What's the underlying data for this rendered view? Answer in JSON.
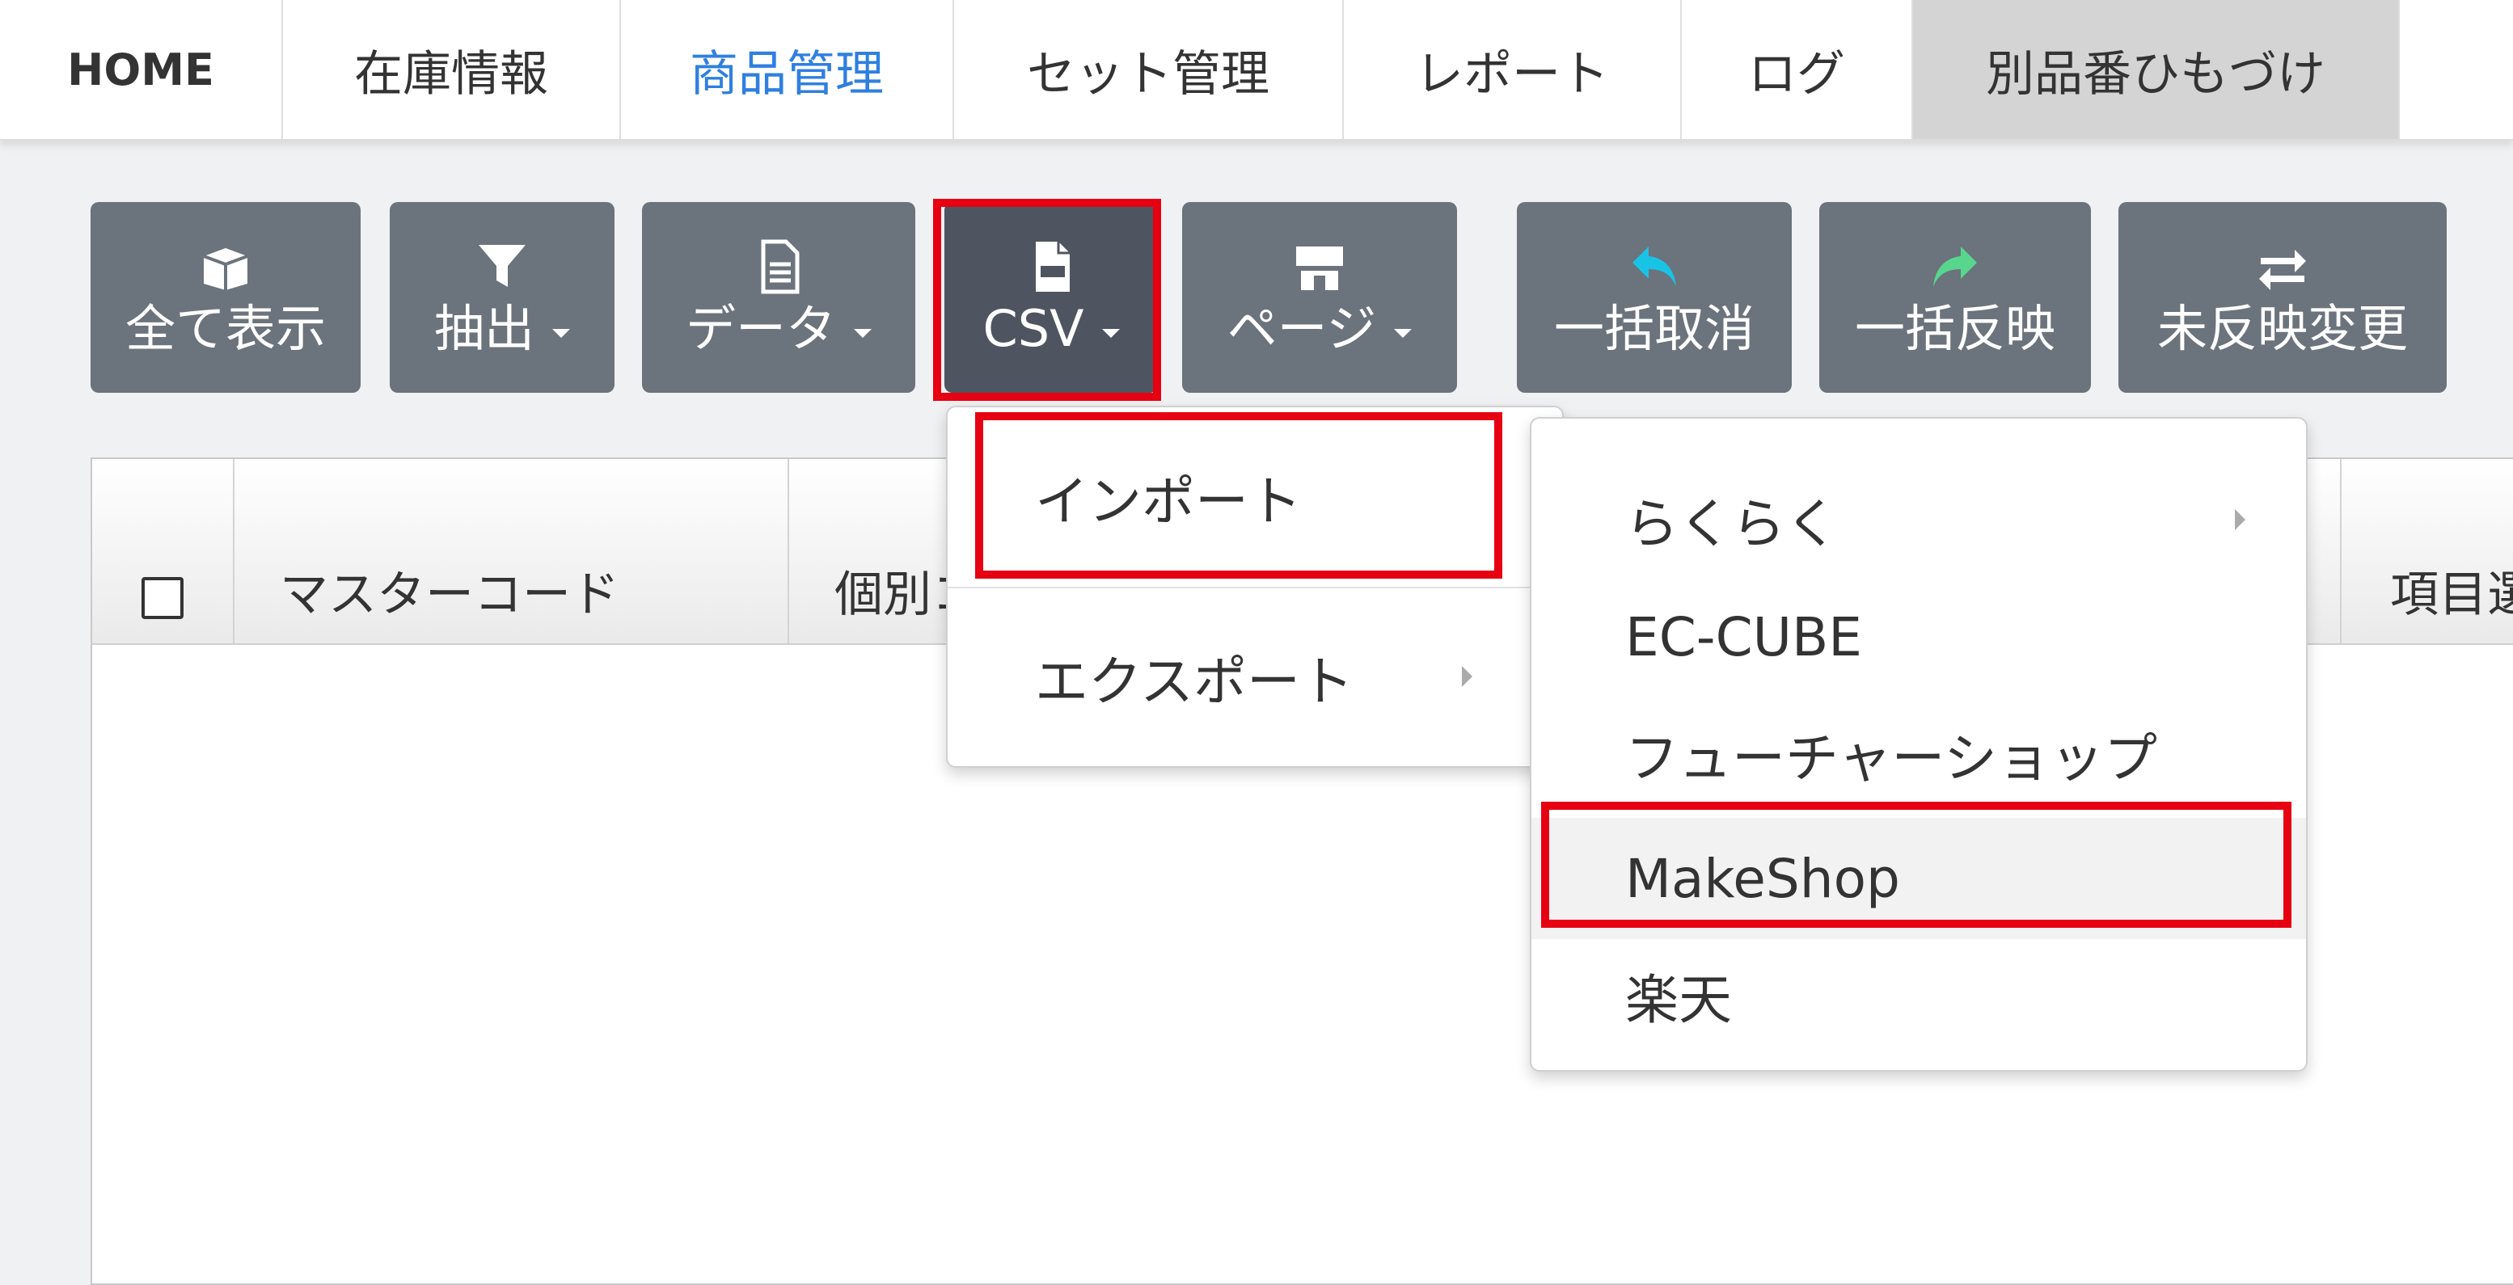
{
  "nav": {
    "home": "HOME",
    "stock_info": "在庫情報",
    "product_management": "商品管理",
    "set_management": "セット管理",
    "report": "レポート",
    "log": "ログ",
    "alt_product_link": "別品番ひもづけ"
  },
  "toolbar": {
    "show_all": "全て表示",
    "extract": "抽出",
    "data": "データ",
    "csv": "CSV",
    "page": "ページ",
    "bulk_cancel": "一括取消",
    "bulk_apply": "一括反映",
    "unapplied_changes": "未反映変更"
  },
  "table": {
    "col_master_code": "マスターコード",
    "col_individual": "個別コ",
    "col_item_select": "項目選"
  },
  "csv_menu": {
    "import": "インポート",
    "export": "エクスポート"
  },
  "import_submenu": {
    "items": [
      "らくらく",
      "EC-CUBE",
      "フューチャーショップ",
      "MakeShop",
      "楽天"
    ]
  },
  "colors": {
    "accent_blue": "#2f7fe0",
    "button_gray": "#6b737c",
    "highlight_red": "#e60012",
    "icon_cyan": "#19c3e6",
    "icon_green": "#58d68d"
  }
}
